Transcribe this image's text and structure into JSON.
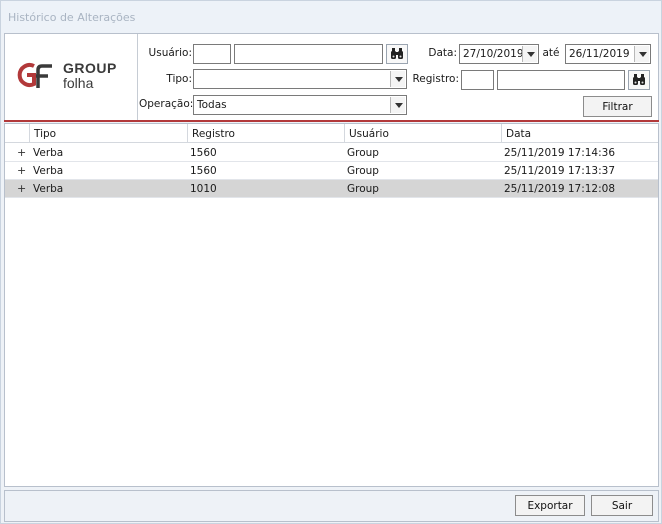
{
  "window": {
    "title": "Histórico de Alterações"
  },
  "logo": {
    "line1": "GROUP",
    "line2": "folha"
  },
  "filters": {
    "usuario_label": "Usuário:",
    "usuario_code": "",
    "usuario_name": "",
    "tipo_label": "Tipo:",
    "tipo_value": "",
    "operacao_label": "Operação:",
    "operacao_value": "Todas",
    "data_label": "Data:",
    "data_from": "27/10/2019",
    "ate_label": "até",
    "data_to": "26/11/2019",
    "registro_label": "Registro:",
    "registro_code": "",
    "registro_name": "",
    "filtrar_label": "Filtrar"
  },
  "grid": {
    "columns": [
      "Tipo",
      "Registro",
      "Usuário",
      "Data"
    ],
    "rows": [
      {
        "expander": "+",
        "tipo": "Verba",
        "registro": "1560",
        "usuario": "Group",
        "data": "25/11/2019 17:14:36",
        "selected": false
      },
      {
        "expander": "+",
        "tipo": "Verba",
        "registro": "1560",
        "usuario": "Group",
        "data": "25/11/2019 17:13:37",
        "selected": false
      },
      {
        "expander": "+",
        "tipo": "Verba",
        "registro": "1010",
        "usuario": "Group",
        "data": "25/11/2019 17:12:08",
        "selected": true
      }
    ]
  },
  "footer": {
    "exportar_label": "Exportar",
    "sair_label": "Sair"
  },
  "colors": {
    "accent_line": "#b2393a",
    "logo_red": "#b2393a",
    "selected_row": "#d5d5d5"
  },
  "icons": {
    "search": "binoculars-icon",
    "dropdown": "chevron-down-icon"
  }
}
